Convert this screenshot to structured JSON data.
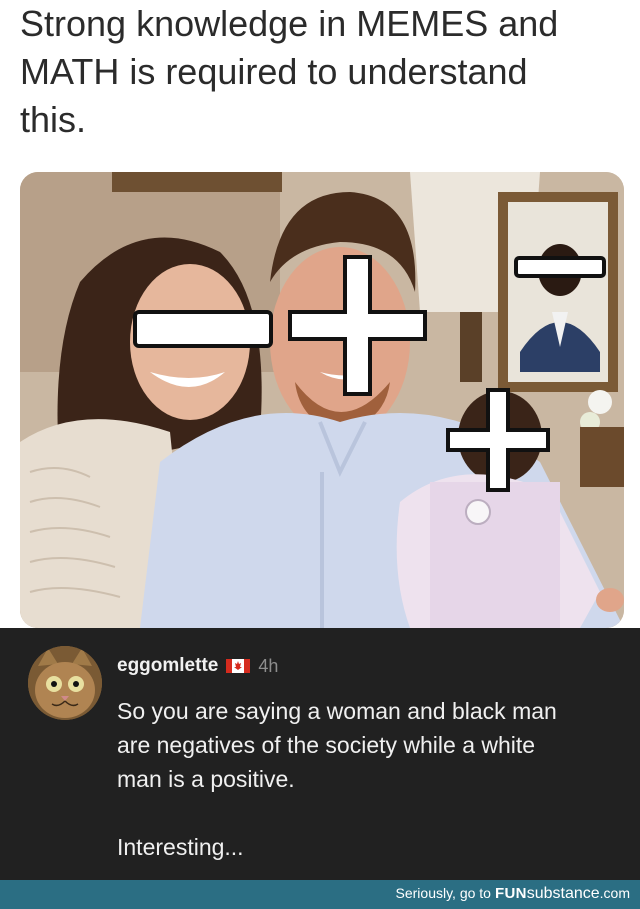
{
  "caption": {
    "line1": "Strong knowledge in MEMES and",
    "line2": "MATH is required to understand",
    "line3": "this."
  },
  "photo": {
    "symbols": [
      "−",
      "+",
      "−",
      "+"
    ]
  },
  "comment": {
    "username": "eggomlette",
    "flag": "canada-flag-icon",
    "timestamp": "4h",
    "text_line1": "So you are saying a woman and black man",
    "text_line2": "are negatives of the society while a white",
    "text_line3": "man is a positive.",
    "text_line4": "Interesting..."
  },
  "footer": {
    "prefix": "Seriously, go to",
    "brand_fun": "FUN",
    "brand_sub": "substance",
    "brand_tld": ".com"
  },
  "colors": {
    "comment_bg": "#212121",
    "footer_bg": "#2b6e83",
    "flag_red": "#d52b1e"
  }
}
